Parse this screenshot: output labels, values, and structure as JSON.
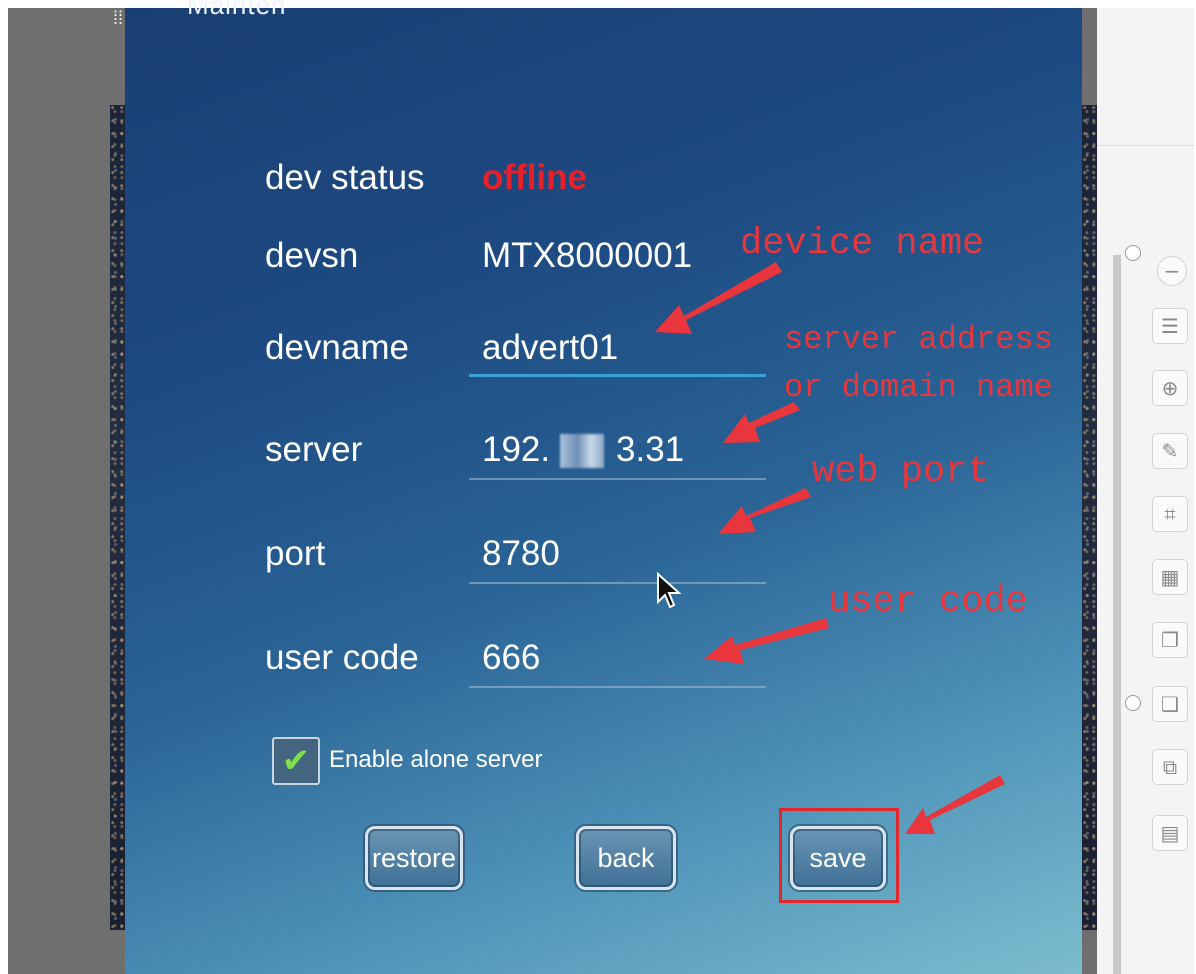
{
  "dialog": {
    "title": "Mainten"
  },
  "form": {
    "dev_status_label": "dev status",
    "dev_status_value": "offline",
    "devsn_label": "devsn",
    "devsn_value": "MTX8000001",
    "devname_label": "devname",
    "devname_value": "advert01",
    "server_label": "server",
    "server_value_prefix": "192.",
    "server_value_suffix": "3.31",
    "port_label": "port",
    "port_value": "8780",
    "user_code_label": "user code",
    "user_code_value": "666",
    "enable_alone_server_label": "Enable alone server",
    "enable_alone_server_checked": true
  },
  "buttons": {
    "restore": "restore",
    "back": "back",
    "save": "save"
  },
  "annotations": {
    "device_name": "device name",
    "server_address_line1": "server address",
    "server_address_line2": "or domain name",
    "web_port": "web port",
    "user_code": "user code"
  },
  "colors": {
    "status_offline": "#e8202a",
    "annotation_red": "#e8363c",
    "checkmark_green": "#7de04a"
  },
  "icons": [
    "zoom-out-icon",
    "layout-icon",
    "zoom-in-icon",
    "pen-icon",
    "crop-icon",
    "frame-icon",
    "copy-icon",
    "paste-icon",
    "duplicate-icon",
    "grid-icon"
  ]
}
